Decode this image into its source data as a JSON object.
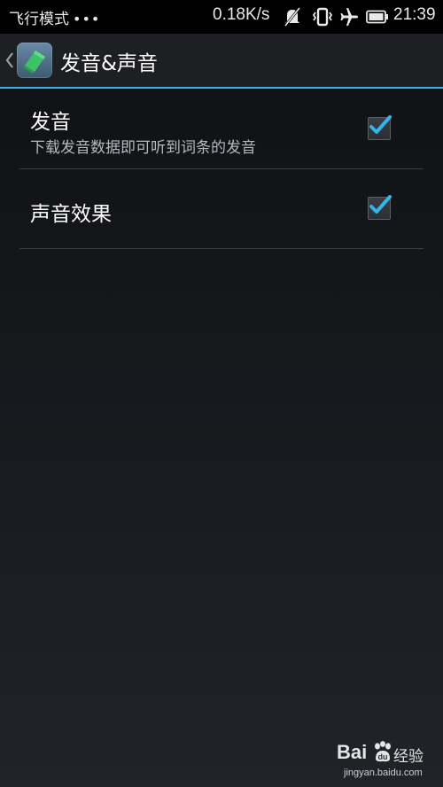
{
  "status_bar": {
    "mode_label": "飞行模式",
    "dots": "•••",
    "rate": "0.18K/s",
    "time": "21:39",
    "icons": [
      "mute-icon",
      "vibrate-icon",
      "airplane-icon",
      "battery-icon"
    ]
  },
  "action_bar": {
    "title": "发音&声音",
    "back_icon": "chevron-left-icon",
    "app_icon": "app-icon",
    "accent": "#33b5e5"
  },
  "prefs": [
    {
      "title": "发音",
      "summary": "下载发音数据即可听到词条的发音",
      "checked": true
    },
    {
      "title": "声音效果",
      "checked": true
    }
  ],
  "watermark": {
    "brand_left": "Bai",
    "brand_right": "经验",
    "url": "jingyan.baidu.com"
  }
}
